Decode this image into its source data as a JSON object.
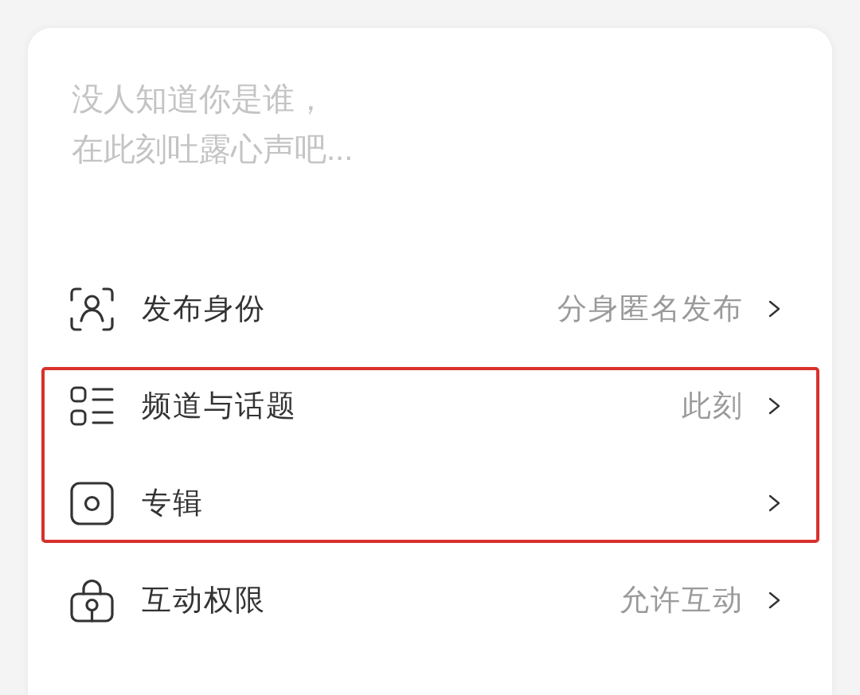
{
  "composer": {
    "placeholder": "没人知道你是谁，在此刻吐露心声吧..."
  },
  "options": [
    {
      "kind": "identity",
      "label": "发布身份",
      "value": "分身匿名发布",
      "highlighted": false
    },
    {
      "kind": "channel",
      "label": "频道与话题",
      "value": "此刻",
      "highlighted": true
    },
    {
      "kind": "album",
      "label": "专辑",
      "highlighted": true
    },
    {
      "kind": "permission",
      "label": "互动权限",
      "value": "允许互动",
      "highlighted": false
    }
  ]
}
